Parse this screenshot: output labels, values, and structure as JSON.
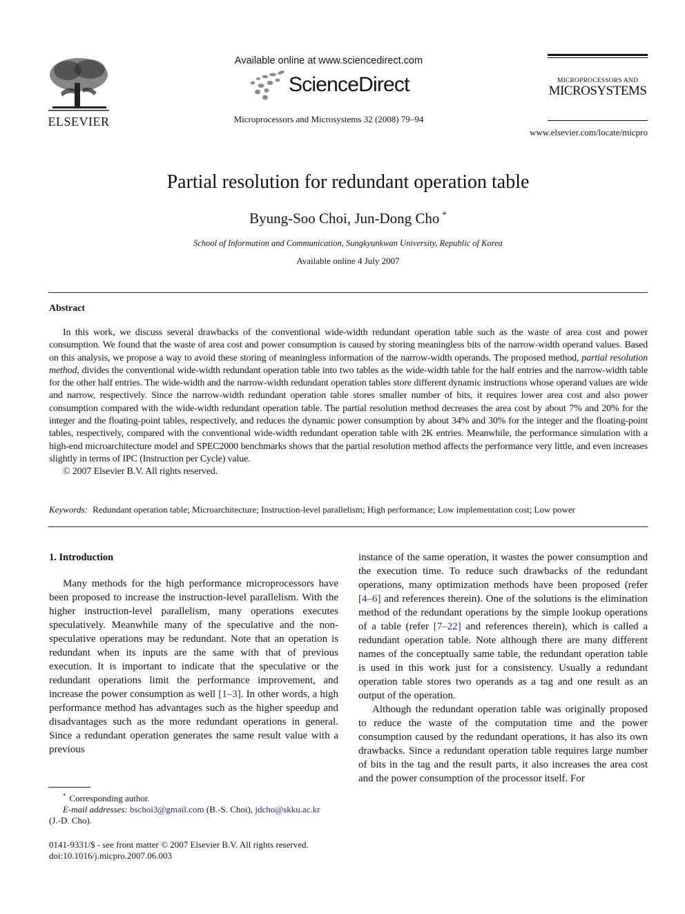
{
  "header": {
    "publisher_logo_text": "ELSEVIER",
    "available_online": "Available online at www.sciencedirect.com",
    "sciencedirect_logo_text": "ScienceDirect",
    "journal_citation": "Microprocessors and Microsystems 32 (2008) 79–94",
    "journal_logo_small": "MICROPROCESSORS AND",
    "journal_logo_big": "MICROSYSTEMS",
    "journal_url": "www.elsevier.com/locate/micpro"
  },
  "article": {
    "title": "Partial resolution for redundant operation table",
    "authors": "Byung-Soo Choi, Jun-Dong Cho",
    "author_mark": "*",
    "affiliation": "School of Information and Communication, Sungkyunkwan University, Republic of Korea",
    "available_date": "Available online 4 July 2007"
  },
  "abstract": {
    "heading": "Abstract",
    "text_before_italic": "In this work, we discuss several drawbacks of the conventional wide-width redundant operation table such as the waste of area cost and power consumption. We found that the waste of area cost and power consumption is caused by storing meaningless bits of the narrow-width operand values. Based on this analysis, we propose a way to avoid these storing of meaningless information of the narrow-width operands. The proposed method, ",
    "italic_term": "partial resolution method",
    "text_after_italic": ", divides the conventional wide-width redundant operation table into two tables as the wide-width table for the half entries and the narrow-width table for the other half entries. The wide-width and the narrow-width redundant operation tables store different dynamic instructions whose operand values are wide and narrow, respectively. Since the narrow-width redundant operation table stores smaller number of bits, it requires lower area cost and also power consumption compared with the wide-width redundant operation table. The partial resolution method decreases the area cost by about 7% and 20% for the integer and the floating-point tables, respectively, and reduces the dynamic power consumption by about 34% and 30% for the integer and the floating-point tables, respectively, compared with the conventional wide-width redundant operation table with 2K entries. Meanwhile, the performance simulation with a high-end microarchitecture model and SPEC2000 benchmarks shows that the partial resolution method affects the performance very little, and even increases slightly in terms of IPC (Instruction per Cycle) value.",
    "copyright": "© 2007 Elsevier B.V. All rights reserved."
  },
  "keywords": {
    "label": "Keywords:",
    "text": "Redundant operation table; Microarchitecture; Instruction-level parallelism; High performance; Low implementation cost; Low power"
  },
  "introduction": {
    "heading": "1. Introduction",
    "left_p1_a": "Many methods for the high performance microprocessors have been proposed to increase the instruction-level parallelism. With the higher instruction-level parallelism, many operations executes speculatively. Meanwhile many of the speculative and the non-speculative operations may be redundant. Note that an operation is redundant when its inputs are the same with that of previous execution. It is important to indicate that the speculative or the redundant operations limit the performance improvement, and increase the power consumption as well ",
    "ref_1_3": "[1–3]",
    "left_p1_b": ". In other words, a high performance method has advantages such as the higher speedup and disadvantages such as the more redundant operations in general. Since a redundant operation generates the same result value with a previous",
    "right_p1_a": "instance of the same operation, it wastes the power consumption and the execution time. To reduce such drawbacks of the redundant operations, many optimization methods have been proposed (refer ",
    "ref_4_6": "[4–6]",
    "right_p1_b": " and references therein). One of the solutions is the elimination method of the redundant operations by the simple lookup operations of a table (refer ",
    "ref_7_22": "[7–22]",
    "right_p1_c": " and references therein), which is called a redundant operation table. Note although there are many different names of the conceptually same table, the redundant operation table is used in this work just for a consistency. Usually a redundant operation table stores two operands as a tag and one result as an output of the operation.",
    "right_p2": "Although the redundant operation table was originally proposed to reduce the waste of the computation time and the power consumption caused by the redundant operations, it has also its own drawbacks. Since a redundant operation table requires large number of bits in the tag and the result parts, it also increases the area cost and the power consumption of the processor itself. For"
  },
  "footnote": {
    "mark": "*",
    "corresponding": "Corresponding author.",
    "email_label": "E-mail addresses:",
    "email1": "bschoi3@gmail.com",
    "email1_who": " (B.-S. Choi), ",
    "email2": "jdcho@skku.ac.kr",
    "email2_who": "(J.-D. Cho).",
    "front_matter": "0141-9331/$ - see front matter  © 2007 Elsevier B.V. All rights reserved.",
    "doi": "doi:10.1016/j.micpro.2007.06.003"
  },
  "colors": {
    "link": "#1a2b8a",
    "text": "#111111"
  }
}
